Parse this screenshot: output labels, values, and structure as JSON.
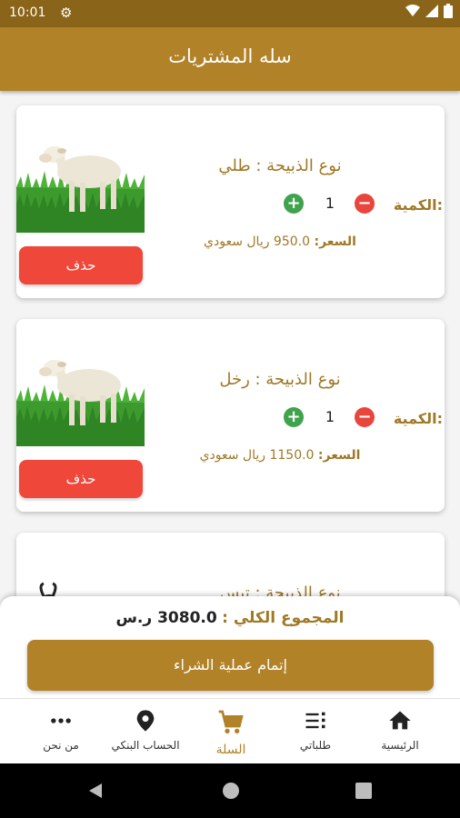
{
  "status": {
    "time": "10:01"
  },
  "header": {
    "title": "سله المشتريات"
  },
  "cart": {
    "items": [
      {
        "type_label": "نوع الذبيحة : طلي",
        "qty_label": "الكمية:",
        "qty": "1",
        "price_label": "السعر:",
        "price_value": "950.0 ريال سعودي",
        "delete_label": "حذف",
        "image": "sheep"
      },
      {
        "type_label": "نوع الذبيحة : رخل",
        "qty_label": "الكمية:",
        "qty": "1",
        "price_label": "السعر:",
        "price_value": "1150.0 ريال سعودي",
        "delete_label": "حذف",
        "image": "sheep"
      },
      {
        "type_label": "نوع الذبيحة : تيس",
        "image": "goat"
      }
    ]
  },
  "footer": {
    "total_label": "المجموع الكلي :",
    "total_value": "3080.0 ر.س",
    "checkout_label": "إتمام عملية الشراء"
  },
  "nav": {
    "items": [
      {
        "label": "الرئيسية",
        "icon": "home-icon"
      },
      {
        "label": "طلباتي",
        "icon": "list-icon"
      },
      {
        "label": "السلة",
        "icon": "cart-icon",
        "active": true
      },
      {
        "label": "الحساب البنكي",
        "icon": "location-icon"
      },
      {
        "label": "من نحن",
        "icon": "more-icon"
      }
    ]
  },
  "colors": {
    "primary": "#b18228",
    "statusbar": "#8a6418",
    "danger": "#ef473a",
    "success": "#3fa34d",
    "text_gold": "#a07826"
  }
}
